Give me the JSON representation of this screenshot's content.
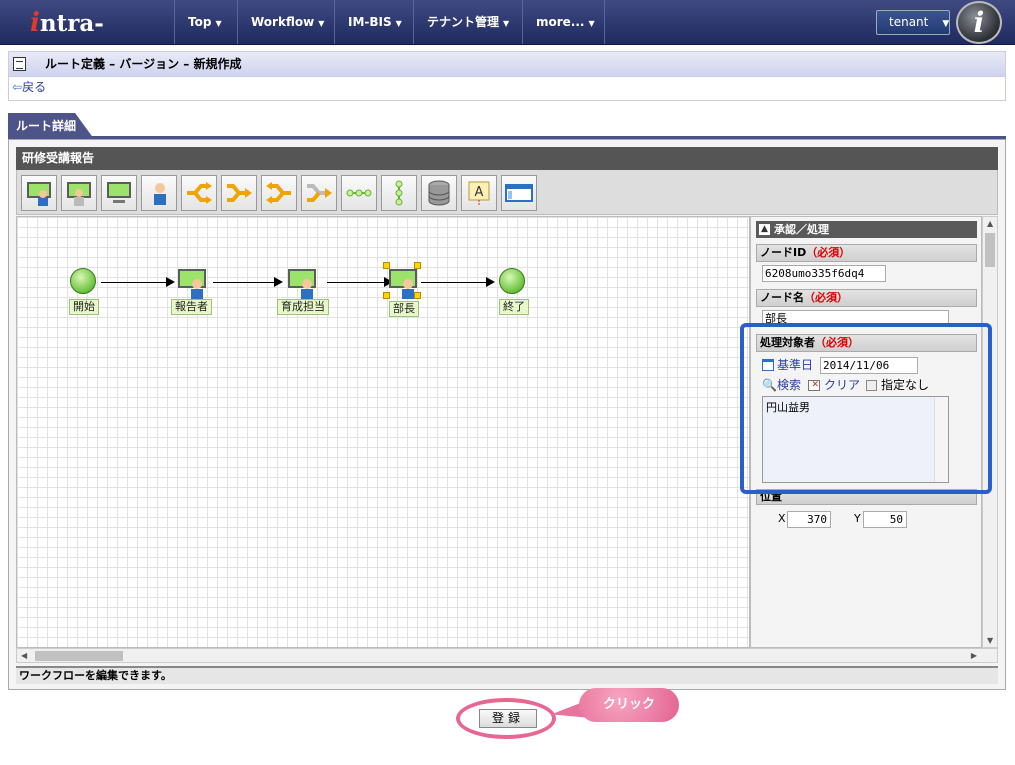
{
  "header": {
    "logo": "intra-mart",
    "nav": [
      "Top",
      "Workflow",
      "IM-BIS",
      "テナント管理",
      "more..."
    ],
    "tenant": "tenant"
  },
  "page": {
    "title": "ルート定義 – バージョン – 新規作成",
    "back": "戻る",
    "tab": "ルート詳細"
  },
  "panel": {
    "title": "研修受講報告",
    "status": "ワークフローを編集できます。",
    "toolbar": [
      "user-node",
      "user-node-multi",
      "system-node",
      "person-node",
      "branch-node",
      "join-node",
      "reverse-branch-node",
      "merge-node",
      "line-node",
      "vertical-line-node",
      "database-node",
      "label-node",
      "window-node"
    ]
  },
  "flow": {
    "nodes": [
      "開始",
      "報告者",
      "育成担当",
      "部長",
      "終了"
    ]
  },
  "properties": {
    "section": "承認／処理",
    "node_id_label": "ノードID",
    "required": "（必須）",
    "node_id": "6208umo335f6dq4",
    "node_name_label": "ノード名",
    "node_name": "部長",
    "target_label": "処理対象者",
    "base_date_label": "基準日",
    "base_date": "2014/11/06",
    "search": "検索",
    "clear": "クリア",
    "none": "指定なし",
    "assignee": "円山益男",
    "position_label": "位置",
    "x_label": "X",
    "x": "370",
    "y_label": "Y",
    "y": "50"
  },
  "footer": {
    "register": "登録",
    "callout": "クリック"
  }
}
